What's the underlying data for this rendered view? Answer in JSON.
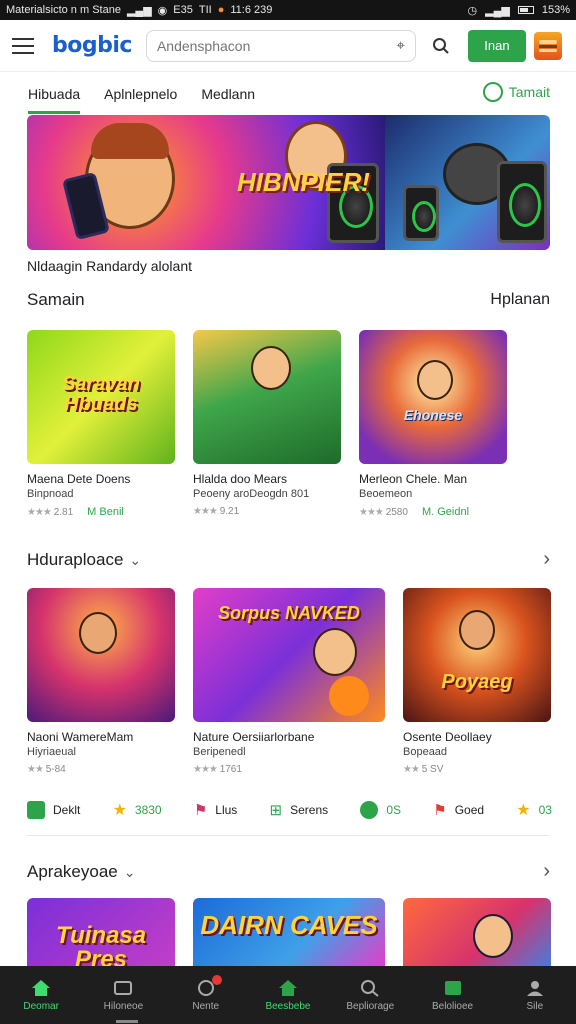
{
  "statusbar": {
    "left_text": "Materialsicto n m Stane",
    "signals": "ill",
    "time_a": "E35",
    "time_b": "TII",
    "clock": "11:6 239",
    "battery": "153%"
  },
  "header": {
    "logo": "bogbic",
    "search_placeholder": "Andensphacon",
    "join_label": "Inan",
    "icons": [
      "menu-icon",
      "search-icon",
      "voice-search-icon",
      "burger-icon"
    ]
  },
  "tabs": {
    "items": [
      "Hibuada",
      "Aplnlepnelo",
      "Medlann"
    ],
    "active": 0,
    "right_label": "Tamait"
  },
  "banner": {
    "title": "HIBNPIER!",
    "caption": "Nldaagin Randardy alolant"
  },
  "section1": {
    "title": "Samain",
    "right_label": "Hplanan",
    "cards": [
      {
        "art_title": "Saravan Hbuads",
        "name": "Maena Dete Doens",
        "sub": "Binpnoad",
        "rating": "2.81",
        "extra": "M Benil"
      },
      {
        "art_title": "",
        "name": "Hlalda doo Mears",
        "sub": "Peoeny aroDeogdn 801",
        "rating": "9.21",
        "extra": ""
      },
      {
        "art_title": "Ehonese",
        "name": "Merleon Chele. Man",
        "sub": "Beoemeon",
        "rating": "2580",
        "extra": "M. Geidnl"
      }
    ]
  },
  "section2": {
    "title": "Hduraploace",
    "cards": [
      {
        "art_title": "",
        "name": "Naoni WamereMam",
        "sub": "Hiyriaeual",
        "rating": "5-84"
      },
      {
        "art_title": "Sorpus NAVKED",
        "name": "Nature Oersiiarlorbane",
        "sub": "Beripenedl",
        "rating": "1761"
      },
      {
        "art_title": "Poyaeg",
        "name": "Osente Deollaey",
        "sub": "Bopeaad",
        "rating": "5 SV"
      }
    ]
  },
  "stats": [
    {
      "icon": "chat-icon",
      "label": "Deklt",
      "color": "#2ea44a"
    },
    {
      "icon": "star-icon",
      "label": "3830",
      "color": "#f2b400"
    },
    {
      "icon": "flag-icon",
      "label": "Llus",
      "color": "#d6336c"
    },
    {
      "icon": "grid-icon",
      "label": "Serens",
      "color": "#2ea44a"
    },
    {
      "icon": "play-icon",
      "label": "0S",
      "color": "#2ea44a"
    },
    {
      "icon": "gift-icon",
      "label": "Goed",
      "color": "#e53935"
    },
    {
      "icon": "star-icon",
      "label": "03",
      "color": "#f2b400"
    }
  ],
  "section3": {
    "title": "Aprakeyoae",
    "cards": [
      {
        "art_title": "Tuinasa Pres"
      },
      {
        "art_title": "DAIRN CAVES"
      },
      {
        "art_title": ""
      }
    ]
  },
  "bottomnav": [
    {
      "label": "Deomar",
      "icon": "home-icon",
      "active": true
    },
    {
      "label": "Hiloneoe",
      "icon": "library-icon",
      "active": false
    },
    {
      "label": "Nente",
      "icon": "notification-icon",
      "active": false
    },
    {
      "label": "Beesbebe",
      "icon": "store-icon",
      "active": false
    },
    {
      "label": "Bepliorage",
      "icon": "search-icon",
      "active": false
    },
    {
      "label": "Belolioee",
      "icon": "game-icon",
      "active": false
    },
    {
      "label": "Sile",
      "icon": "profile-icon",
      "active": false
    }
  ]
}
